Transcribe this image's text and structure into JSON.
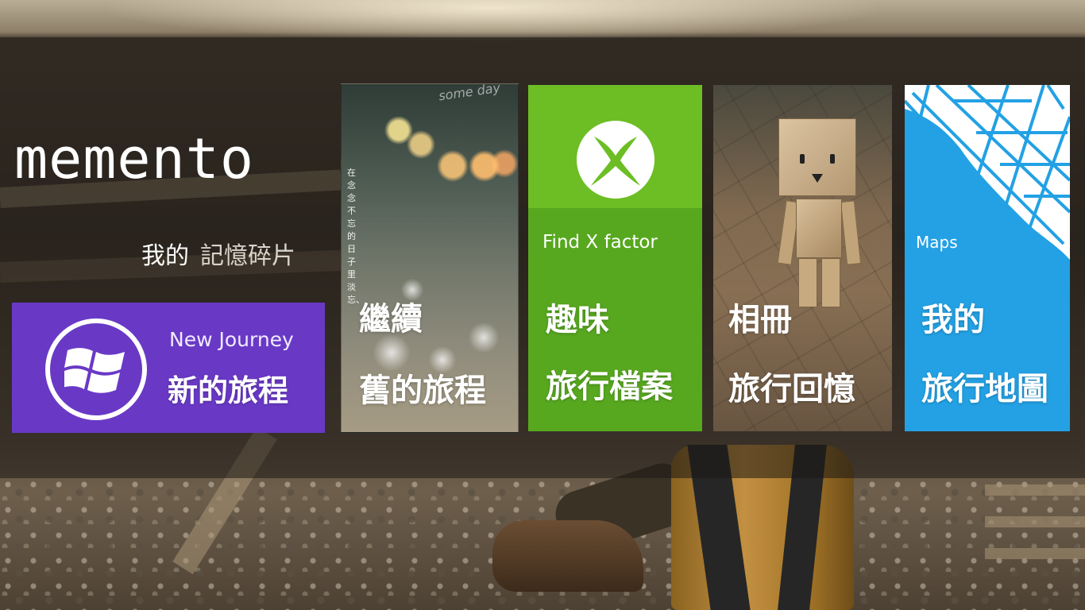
{
  "app": {
    "title": "memento",
    "subtitle_a": "我的",
    "subtitle_b": "記憶碎片"
  },
  "tiles": {
    "new_journey": {
      "small_label": "New Journey",
      "label": "新的旅程",
      "icon": "windows-logo-icon",
      "color": "#6939c6"
    },
    "continue_journey": {
      "label_line1": "繼續",
      "label_line2": "舊的旅程",
      "vertical_text": "在念念不忘的日子里淡忘、",
      "corner_text": "some day"
    },
    "fun": {
      "small_label": "Find X factor",
      "label_line1": "趣味",
      "label_line2": "旅行檔案",
      "icon": "xbox-icon",
      "color": "#57a81f"
    },
    "album": {
      "label_line1": "相冊",
      "label_line2": "旅行回憶"
    },
    "maps": {
      "small_label": "Maps",
      "label_line1": "我的",
      "label_line2": "旅行地圖",
      "icon": "map-icon",
      "color": "#23a1e4"
    }
  }
}
